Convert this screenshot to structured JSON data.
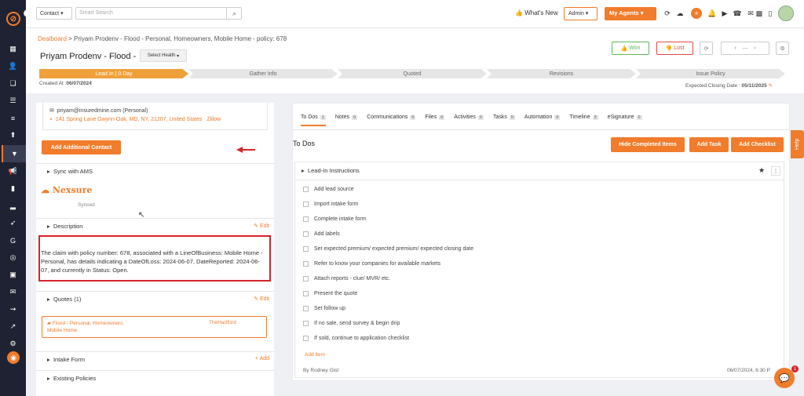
{
  "topbar": {
    "contact_select": "Contact",
    "search_placeholder": "Smart Search",
    "whats_new": "What's New",
    "admin": "Admin",
    "my_agents": "My Agents"
  },
  "header": {
    "breadcrumb_root": "Dealboard",
    "breadcrumb_rest": " > Priyam Prodenv - Flood - Personal, Homeowners, Mobile Home - policy: 678",
    "title": "Priyam Prodenv - Flood -",
    "health": "Select Health",
    "won": "Won",
    "lost": "Lost",
    "created_label": "Created At :",
    "created_value": "06/07/2024",
    "closing_label": "Expected Closing Date :",
    "closing_value": "05/11/2025"
  },
  "stages": [
    "Lead In | 0 Day",
    "Gather Info",
    "Quoted",
    "Revisions",
    "Issue Policy"
  ],
  "left": {
    "email": "priyam@insuredmine.com (Personal)",
    "address": "141 Spring Lane Gwynn Oak, MD, NY, 21207, United States",
    "zillow": "Zillow",
    "add_contact": "Add Additional Contact",
    "sync": "Sync with AMS",
    "nexsure": "Nexsure",
    "synced": "Synced",
    "description_label": "Description",
    "edit": "Edit",
    "description": "The claim with policy number: 678, associated with a LineOfBusiness: Mobile Home - Personal, has details indicating a DateOfLoss: 2024-06-07, DateReported: 2024-06-07, and currently in Status: Open.",
    "quotes_label": "Quotes (1)",
    "quote_name": "Flood - Personal, Homeowners, Mobile Home",
    "quote_carrier": "TheHartford",
    "intake_label": "Intake Form",
    "add": "Add",
    "existing_label": "Existing Policies"
  },
  "right": {
    "tabs": [
      {
        "label": "To Dos",
        "count": "1"
      },
      {
        "label": "Notes",
        "count": "0"
      },
      {
        "label": "Communications",
        "count": "0"
      },
      {
        "label": "Files",
        "count": "0"
      },
      {
        "label": "Activities",
        "count": "0"
      },
      {
        "label": "Tasks",
        "count": "0"
      },
      {
        "label": "Automation",
        "count": "0"
      },
      {
        "label": "Timeline",
        "count": "3"
      },
      {
        "label": "eSignature",
        "count": "0"
      }
    ],
    "heading": "To Dos",
    "hide_completed": "Hide Completed Items",
    "add_task": "Add Task",
    "add_checklist": "Add Checklist",
    "checklist_title": "Lead-In Instructions",
    "items": [
      "Add lead source",
      "Import intake form",
      "Complete intake form",
      "Add labels",
      "Set expected premium/ expected premium/ expected closing date",
      "Refer to know your companies for available markets",
      "Attach reports - clue/ MVR/ etc.",
      "Present the quote",
      "Set follow up",
      "If no sale, send survey & begin drip",
      "If sold, continue to application checklist"
    ],
    "add_item": "Add Item",
    "byline": "By Rodney Gist",
    "date": "06/07/2024, 6:30 P"
  },
  "help": "Help",
  "chat_badge": "1"
}
